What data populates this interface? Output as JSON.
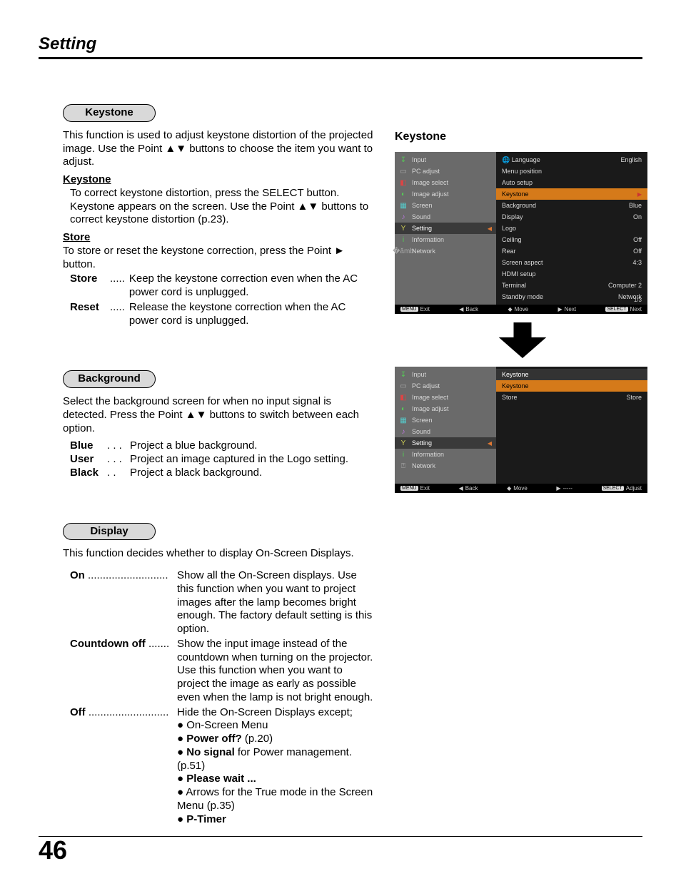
{
  "header": {
    "title": "Setting"
  },
  "page_number": "46",
  "sections": {
    "keystone": {
      "tag": "Keystone",
      "intro": "This function is used to adjust keystone distortion of the projected image. Use the Point ▲▼ buttons to choose the item you want to adjust.",
      "sub1_title": "  Keystone",
      "sub1_body": "To correct keystone distortion, press the SELECT button. Keystone appears on the screen. Use the Point ▲▼ buttons to correct keystone distortion (p.23).",
      "sub2_title": " Store",
      "sub2_body": "To store or reset the keystone correction, press the Point ► button.",
      "store_term": "Store",
      "store_dots": ".....",
      "store_desc": "Keep the keystone correction even when the AC power cord is unplugged.",
      "reset_term": "Reset",
      "reset_dots": ".....",
      "reset_desc": "Release the keystone correction when the AC power cord is unplugged."
    },
    "background": {
      "tag": "Background",
      "intro": "Select the background screen for when no input signal is detected. Press the Point ▲▼ buttons to switch between each option.",
      "blue_term": "Blue",
      "blue_dots": ". . .",
      "blue_desc": "Project a blue background.",
      "user_term": "User",
      "user_dots": ". . .",
      "user_desc": "Project an image captured in the Logo setting.",
      "black_term": "Black",
      "black_dots": ". .",
      "black_desc": "Project a black background."
    },
    "display": {
      "tag": "Display",
      "intro": "This function decides whether to display On-Screen Displays.",
      "on_term": "On",
      "on_dots": " ...........................",
      "on_desc": "Show all the On-Screen displays. Use this function when you want to project images after the lamp becomes bright enough. The factory default setting is this option.",
      "cd_term": "Countdown off",
      "cd_dots": " .......",
      "cd_desc": "Show the input image instead of the countdown when turning on the projector. Use this function when you want to project the image as early as possible even when the lamp is not bright enough.",
      "off_term": "Off",
      "off_dots": " ...........................",
      "off_desc": "Hide the On-Screen Displays except;",
      "off_list": {
        "i1": "On-Screen Menu",
        "i2a": "Power off?",
        "i2b": " (p.20)",
        "i3a": "No signal",
        "i3b": " for Power management. (p.51)",
        "i4": "Please wait ...",
        "i5": "Arrows for the True mode in the Screen Menu (p.35)",
        "i6": "P-Timer"
      }
    }
  },
  "right": {
    "title": "Keystone",
    "osd1": {
      "left": [
        {
          "label": "Input",
          "icon": "↧",
          "cls": "ic-green"
        },
        {
          "label": "PC adjust",
          "icon": "▭",
          "cls": "ic-gray"
        },
        {
          "label": "Image select",
          "icon": "◧",
          "cls": "ic-red"
        },
        {
          "label": "Image adjust",
          "icon": "◐",
          "cls": "ic-green"
        },
        {
          "label": "Screen",
          "icon": "▦",
          "cls": "ic-teal"
        },
        {
          "label": "Sound",
          "icon": "♪",
          "cls": "ic-pur"
        },
        {
          "label": "Setting",
          "icon": "Y",
          "cls": "ic-yel",
          "active": true
        },
        {
          "label": "Information",
          "icon": "i",
          "cls": "ic-green"
        },
        {
          "label": "Network",
          "icon": "�ămb",
          "cls": "ic-gray"
        }
      ],
      "right": [
        {
          "label": "Language",
          "value": "English",
          "globe": true
        },
        {
          "label": "Menu position",
          "value": ""
        },
        {
          "label": "Auto setup",
          "value": ""
        },
        {
          "label": "Keystone",
          "value": "",
          "hl": true,
          "tri": true
        },
        {
          "label": "Background",
          "value": "Blue"
        },
        {
          "label": "Display",
          "value": "On"
        },
        {
          "label": "Logo",
          "value": ""
        },
        {
          "label": "Ceiling",
          "value": "Off"
        },
        {
          "label": "Rear",
          "value": "Off"
        },
        {
          "label": "Screen aspect",
          "value": "4:3"
        },
        {
          "label": "HDMI setup",
          "value": ""
        },
        {
          "label": "Terminal",
          "value": "Computer 2"
        },
        {
          "label": "Standby mode",
          "value": "Network"
        }
      ],
      "pagecount": "1/3",
      "footer": {
        "exit": "Exit",
        "back": "Back",
        "move": "Move",
        "next": "Next",
        "sel": "Next"
      }
    },
    "osd2": {
      "left": [
        {
          "label": "Input",
          "icon": "↧",
          "cls": "ic-green"
        },
        {
          "label": "PC adjust",
          "icon": "▭",
          "cls": "ic-gray"
        },
        {
          "label": "Image select",
          "icon": "◧",
          "cls": "ic-red"
        },
        {
          "label": "Image adjust",
          "icon": "◐",
          "cls": "ic-green"
        },
        {
          "label": "Screen",
          "icon": "▦",
          "cls": "ic-teal"
        },
        {
          "label": "Sound",
          "icon": "♪",
          "cls": "ic-pur"
        },
        {
          "label": "Setting",
          "icon": "Y",
          "cls": "ic-yel",
          "active": true
        },
        {
          "label": "Information",
          "icon": "i",
          "cls": "ic-green"
        },
        {
          "label": "Network",
          "icon": "⍰",
          "cls": "ic-gray"
        }
      ],
      "right_header": "Keystone",
      "right": [
        {
          "label": "Keystone",
          "value": "",
          "hl": true
        },
        {
          "label": "Store",
          "value": "Store"
        }
      ],
      "footer": {
        "exit": "Exit",
        "back": "Back",
        "move": "Move",
        "next": "-----",
        "sel": "Adjust"
      }
    }
  }
}
